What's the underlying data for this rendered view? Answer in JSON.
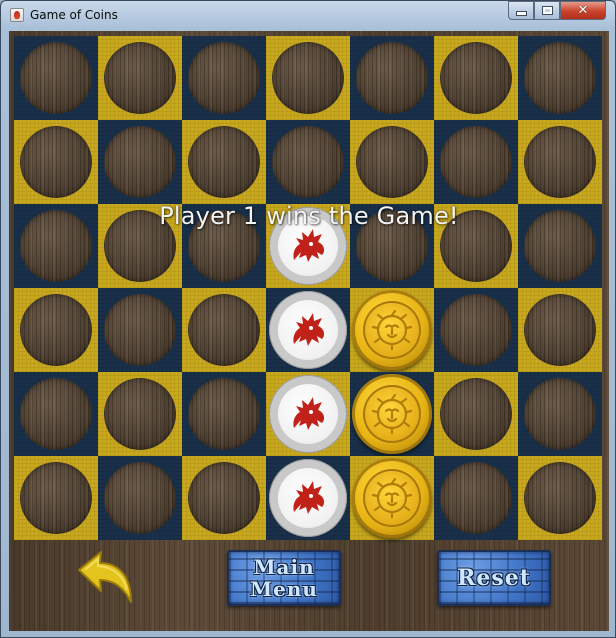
{
  "window": {
    "title": "Game of Coins",
    "controls": {
      "minimize": "–",
      "maximize": "□",
      "close": "✕"
    }
  },
  "game": {
    "message": "Player 1 wins the Game!",
    "columns": 7,
    "rows": 6,
    "pieces": [
      {
        "row": 3,
        "col": 4,
        "player": "red"
      },
      {
        "row": 4,
        "col": 4,
        "player": "red"
      },
      {
        "row": 5,
        "col": 4,
        "player": "red"
      },
      {
        "row": 6,
        "col": 4,
        "player": "red"
      },
      {
        "row": 4,
        "col": 5,
        "player": "gold"
      },
      {
        "row": 5,
        "col": 5,
        "player": "gold"
      },
      {
        "row": 6,
        "col": 5,
        "player": "gold"
      }
    ],
    "colors": {
      "board_yellow": "#c9a81c",
      "board_navy": "#18304a",
      "player1_red": "#c0221a",
      "player2_gold": "#e5ae18"
    },
    "icons": {
      "player1": "dragon-icon",
      "player2": "lion-icon"
    }
  },
  "footer": {
    "back_icon": "back-arrow-icon",
    "menu_line1": "Main",
    "menu_line2": "Menu",
    "reset_label": "Reset"
  }
}
